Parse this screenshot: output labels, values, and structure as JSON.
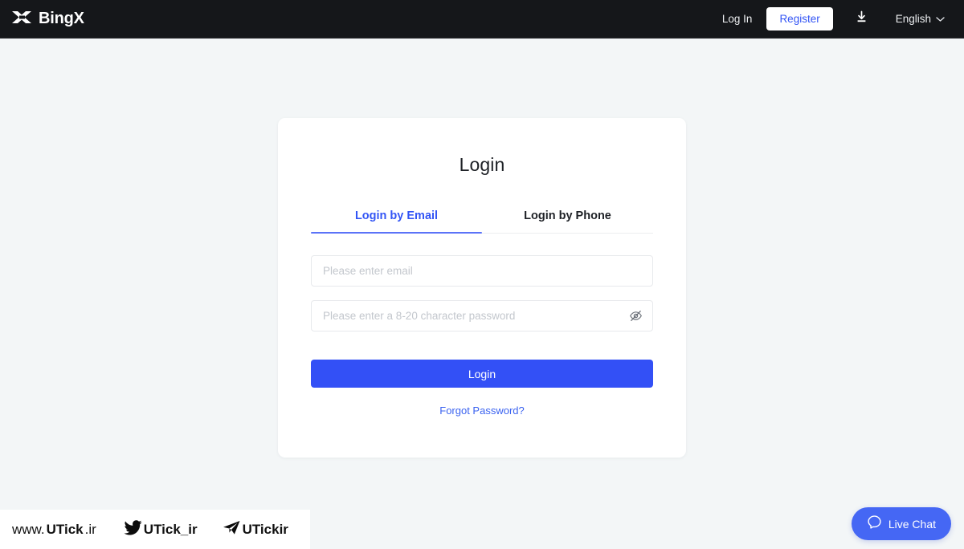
{
  "header": {
    "brand_name": "BingX",
    "brand_logo_icon": "bingx-x-logo-icon",
    "login_label": "Log In",
    "register_label": "Register",
    "download_icon": "download-icon",
    "language_label": "English",
    "language_chevron_icon": "chevron-down-icon",
    "background_color": "#15171a",
    "register_text_color": "#3355f5"
  },
  "login_card": {
    "title": "Login",
    "tabs": [
      {
        "label": "Login by Email",
        "active": true
      },
      {
        "label": "Login by Phone",
        "active": false
      }
    ],
    "email_field": {
      "placeholder": "Please enter email",
      "value": ""
    },
    "password_field": {
      "placeholder": "Please enter a 8-20 character password",
      "value": "",
      "toggle_icon": "eye-off-icon"
    },
    "submit_label": "Login",
    "forgot_password_label": "Forgot Password?",
    "accent_color": "#3350f6",
    "active_tab_color": "#3355f5"
  },
  "watermark": {
    "site_prefix": "www.",
    "site_bold": "UTick",
    "site_suffix": ".ir",
    "twitter_icon": "twitter-bird-icon",
    "twitter_handle": "UTick_ir",
    "telegram_icon": "telegram-plane-icon",
    "telegram_handle": "UTickir"
  },
  "live_chat": {
    "label": "Live Chat",
    "icon": "chat-bubble-icon",
    "background_color": "#4567f4"
  },
  "page": {
    "background_color": "#f3f6f7"
  }
}
